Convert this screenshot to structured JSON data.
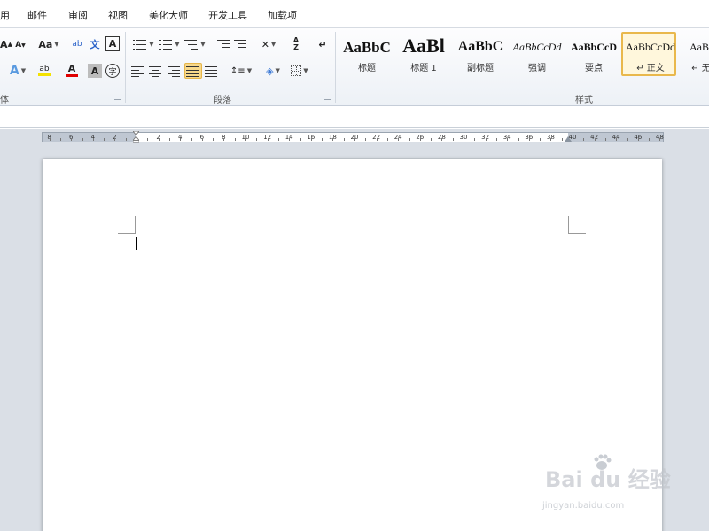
{
  "menu": {
    "tabs": [
      "用",
      "邮件",
      "审阅",
      "视图",
      "美化大师",
      "开发工具",
      "加载项"
    ]
  },
  "ribbon": {
    "font_group": {
      "label": "体",
      "grow_font": "A",
      "shrink_font": "A",
      "change_case": "Aa",
      "phonetic": "文",
      "enclose": "文",
      "char_border": "A",
      "text_effect": "A",
      "highlight": "ab",
      "font_color": "A",
      "char_shading": "A",
      "enclose_char": "字",
      "font_color_hex": "#e00000",
      "highlight_hex": "#f4e200"
    },
    "paragraph_group": {
      "label": "段落",
      "sort": "A",
      "sort_sub": "Z",
      "show_marks": "↵"
    },
    "styles_group": {
      "label": "样式",
      "items": [
        {
          "preview": "AaBbC",
          "label": "标题"
        },
        {
          "preview": "AaBl",
          "label": "标题 1"
        },
        {
          "preview": "AaBbC",
          "label": "副标题"
        },
        {
          "preview": "AaBbCcDd",
          "label": "强调"
        },
        {
          "preview": "AaBbCcD",
          "label": "要点"
        },
        {
          "preview": "AaBbCcDd",
          "label": "↵ 正文"
        },
        {
          "preview": "AaBbC",
          "label": "↵ 无间"
        }
      ],
      "selected_index": 5
    }
  },
  "ruler": {
    "left_numbers": [
      "8",
      "6",
      "4",
      "2"
    ],
    "right_numbers": [
      "2",
      "4",
      "6",
      "8",
      "10",
      "12",
      "14",
      "16",
      "18",
      "20",
      "22",
      "24",
      "26",
      "28",
      "30",
      "32",
      "34",
      "36",
      "38",
      "40",
      "42",
      "44",
      "46",
      "48"
    ]
  },
  "watermark": {
    "brand": "Bai du 经验",
    "url": "jingyan.baidu.com"
  }
}
